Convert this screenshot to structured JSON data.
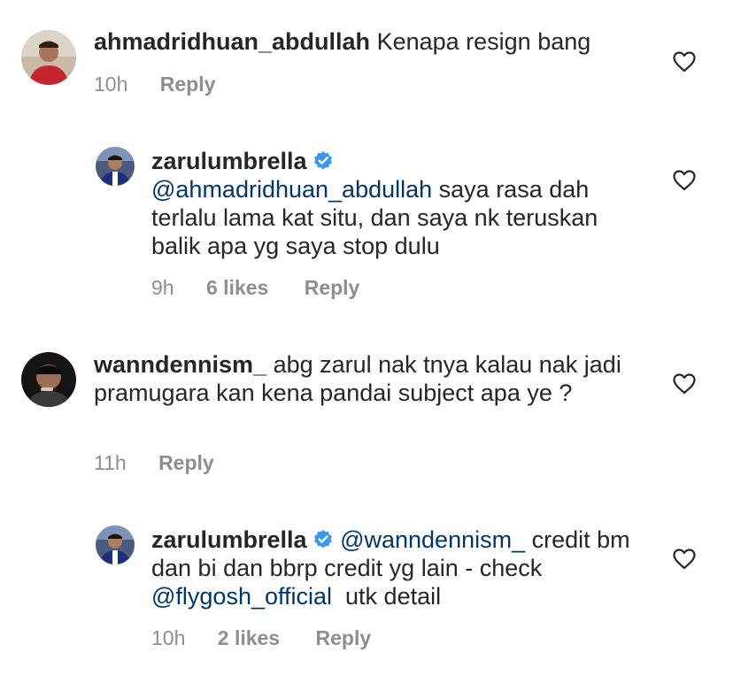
{
  "comments": [
    {
      "username": "ahmadridhuan_abdullah",
      "verified": false,
      "text_parts": [
        "Kenapa resign bang"
      ],
      "time": "10h",
      "likes": "",
      "reply_label": "Reply"
    },
    {
      "username": "zarulumbrella",
      "verified": true,
      "mention": "@ahmadridhuan_abdullah",
      "text_parts": [
        " saya rasa dah terlalu lama kat situ, dan saya nk teruskan balik apa yg saya stop dulu"
      ],
      "time": "9h",
      "likes": "6 likes",
      "reply_label": "Reply"
    },
    {
      "username": "wanndennism_",
      "verified": false,
      "text_parts": [
        "abg zarul nak tnya kalau nak jadi pramugara kan kena pandai subject apa ye ?"
      ],
      "time": "11h",
      "likes": "",
      "reply_label": "Reply"
    },
    {
      "username": "zarulumbrella",
      "verified": true,
      "mention": "@wanndennism_",
      "text_mid": " credit bm dan bi dan bbrp credit yg lain - check ",
      "mention2": "@flygosh_official",
      "text_end": "  utk detail",
      "time": "10h",
      "likes": "2 likes",
      "reply_label": "Reply"
    }
  ],
  "icons": {
    "like": "heart-outline-icon",
    "verified": "verified-badge-icon"
  },
  "colors": {
    "text": "#262626",
    "meta": "#8e8e8e",
    "mention": "#00376b",
    "verified": "#3897f0"
  }
}
